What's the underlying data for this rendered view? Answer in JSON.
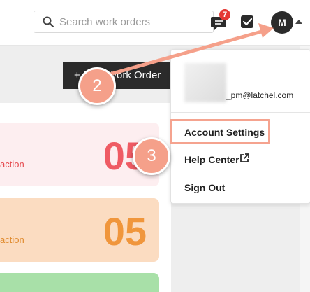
{
  "header": {
    "search_placeholder": "Search work orders",
    "notification_count": "7",
    "avatar_initial": "M"
  },
  "toolbar": {
    "new_work_order_label": "+ New Work Order"
  },
  "cards": [
    {
      "label": "action",
      "count": "05",
      "color": "#ef5b64"
    },
    {
      "label": "action",
      "count": "05",
      "color": "#f0963c"
    }
  ],
  "dropdown": {
    "email": "_pm@latchel.com",
    "items": [
      {
        "label": "Account Settings"
      },
      {
        "label": "Help Center"
      },
      {
        "label": "Sign Out"
      }
    ]
  },
  "annotations": {
    "step_2": "2",
    "step_3": "3",
    "accent_color": "#f5a08a"
  }
}
